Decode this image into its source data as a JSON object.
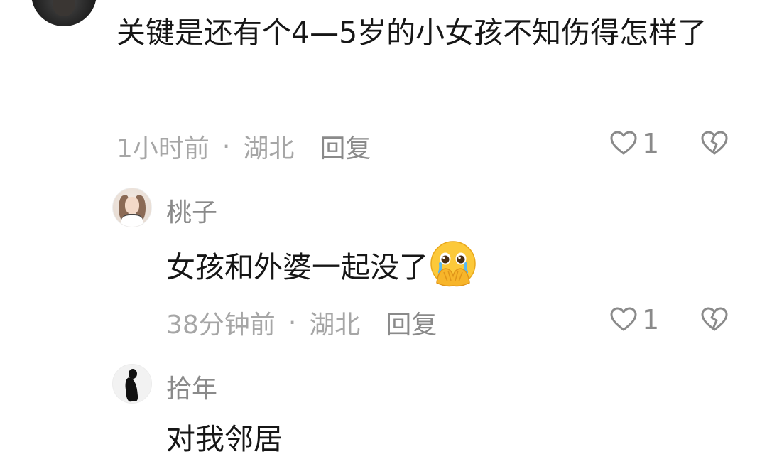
{
  "comments": [
    {
      "text": "关键是还有个4—5岁的小女孩不知伤得怎样了",
      "time": "1小时前",
      "separator": "·",
      "location": "湖北",
      "reply_label": "回复",
      "likes": "1"
    },
    {
      "username": "桃子",
      "text": "女孩和外婆一起没了",
      "emoji": "crying-hands-emoji",
      "time": "38分钟前",
      "separator": "·",
      "location": "湖北",
      "reply_label": "回复",
      "likes": "1"
    },
    {
      "username": "拾年",
      "text": "对我邻居"
    }
  ],
  "icons": {
    "like": "heart-outline-icon",
    "dislike": "broken-heart-outline-icon"
  },
  "colors": {
    "text_primary": "#161616",
    "text_secondary": "#a6a6a6",
    "username": "#8a8a8a"
  }
}
